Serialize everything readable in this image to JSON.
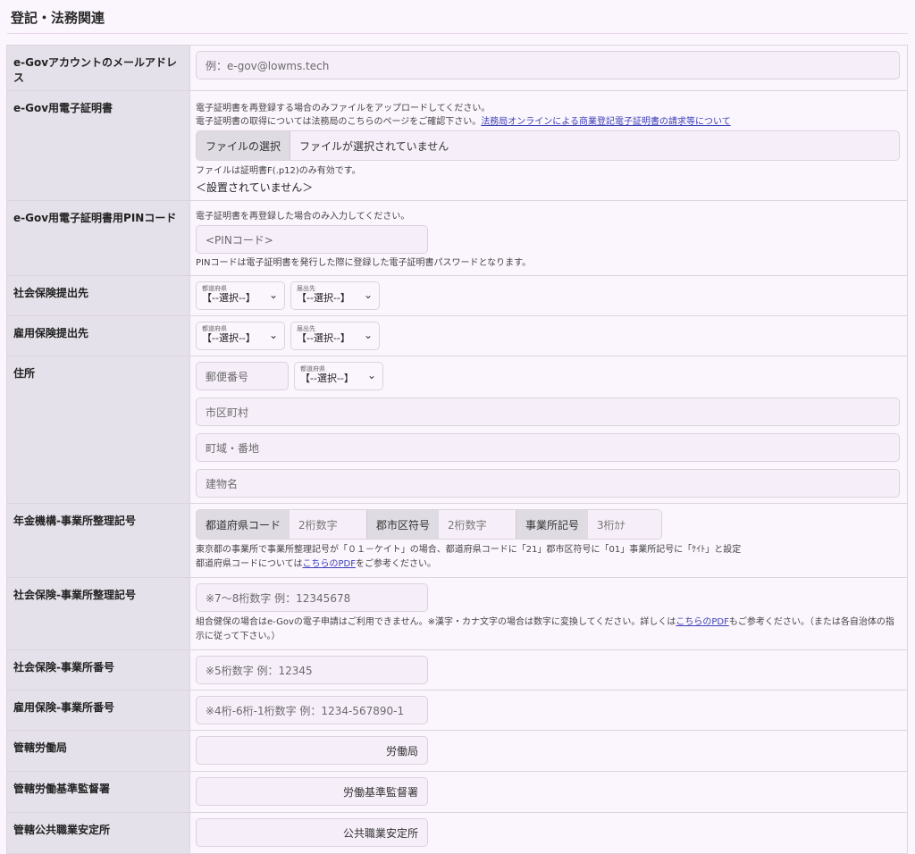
{
  "page": {
    "title": "登記・法務関連"
  },
  "rows": {
    "email": {
      "label": "e-Govアカウントのメールアドレス",
      "placeholder": "例：e-gov@lowms.tech"
    },
    "cert": {
      "label": "e-Gov用電子証明書",
      "help1": "電子証明書を再登録する場合のみファイルをアップロードしてください。",
      "help2": "電子証明書の取得については法務局のこちらのページをご確認下さい。",
      "help2_link": "法務局オンラインによる商業登記電子証明書の請求等について",
      "file_button": "ファイルの選択",
      "file_text": "ファイルが選択されていません",
      "file_note": "ファイルは証明書F(.p12)のみ有効です。",
      "status": "＜設置されていません＞"
    },
    "pin": {
      "label": "e-Gov用電子証明書用PINコード",
      "help": "電子証明書を再登録した場合のみ入力してください。",
      "placeholder": "<PINコード>",
      "note": "PINコードは電子証明書を発行した際に登録した電子証明書パスワードとなります。"
    },
    "shakai_dest": {
      "label": "社会保険提出先",
      "pref_caption": "都道府県",
      "pref_value": "【--選択--】",
      "dest_caption": "届出先",
      "dest_value": "【--選択--】"
    },
    "koyo_dest": {
      "label": "雇用保険提出先",
      "pref_caption": "都道府県",
      "pref_value": "【--選択--】",
      "dest_caption": "届出先",
      "dest_value": "【--選択--】"
    },
    "address": {
      "label": "住所",
      "zip_placeholder": "郵便番号",
      "pref_caption": "都道府県",
      "pref_value": "【--選択--】",
      "city_placeholder": "市区町村",
      "street_placeholder": "町域・番地",
      "building_placeholder": "建物名"
    },
    "nenkin": {
      "label": "年金機構-事業所整理記号",
      "pref_code_label": "都道府県コード",
      "pref_code_placeholder": "2桁数字",
      "city_code_label": "郡市区符号",
      "city_code_placeholder": "2桁数字",
      "office_code_label": "事業所記号",
      "office_code_placeholder": "3桁ｶﾅ",
      "note1": "東京都の事業所で事業所整理記号が「０１－ケイト」の場合、都道府県コードに「21」郡市区符号に「01」事業所記号に「ｹｲﾄ」と設定",
      "note2_pre": "都道府県コードについては",
      "note2_link": "こちらのPDF",
      "note2_post": "をご参考ください。"
    },
    "shakai_seiri": {
      "label": "社会保険-事業所整理記号",
      "placeholder": "※7～8桁数字 例：12345678",
      "note_pre": "組合健保の場合はe-Govの電子申請はご利用できません。※漢字・カナ文字の場合は数字に変換してください。詳しくは",
      "note_link": "こちらのPDF",
      "note_post": "もご参考ください。（または各自治体の指示に従って下さい。）"
    },
    "shakai_bango": {
      "label": "社会保険-事業所番号",
      "placeholder": "※5桁数字 例：12345"
    },
    "koyo_bango": {
      "label": "雇用保険-事業所番号",
      "placeholder": "※4桁-6桁-1桁数字 例：1234-567890-1"
    },
    "roudoukyoku": {
      "label": "管轄労働局",
      "suffix": "労働局"
    },
    "kantokusho": {
      "label": "管轄労働基準監督署",
      "suffix": "労働基準監督署"
    },
    "anteisho": {
      "label": "管轄公共職業安定所",
      "suffix": "公共職業安定所"
    }
  }
}
